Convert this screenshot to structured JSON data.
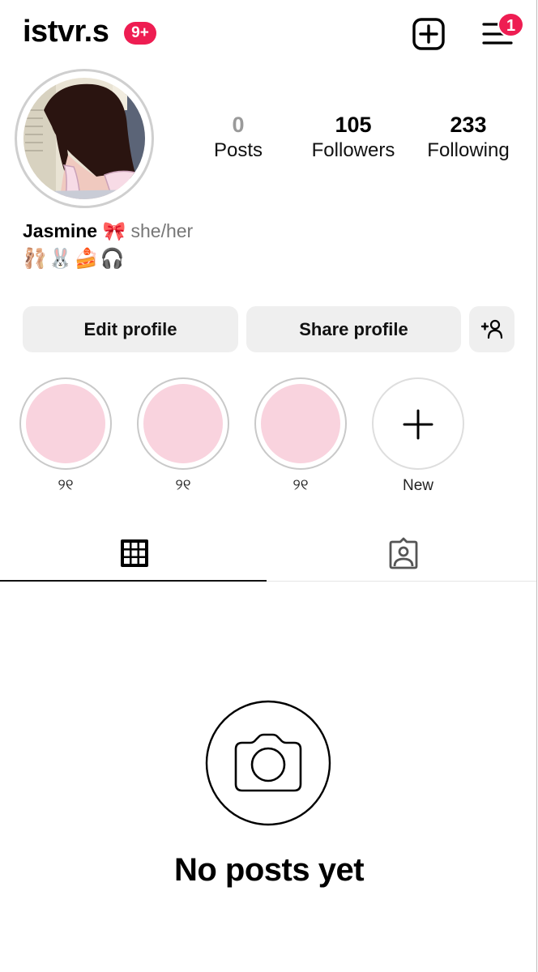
{
  "header": {
    "username": "istvr.s",
    "notification_badge": "9+",
    "create_icon": "plus-square-icon",
    "menu_icon": "hamburger-menu-icon",
    "menu_badge": "1",
    "badge_color": "#ee1d52"
  },
  "profile": {
    "avatar_icon": "profile-photo",
    "stats": [
      {
        "value": "0",
        "label": "Posts"
      },
      {
        "value": "105",
        "label": "Followers"
      },
      {
        "value": "233",
        "label": "Following"
      }
    ],
    "display_name": "Jasmine",
    "name_emoji": "🎀",
    "pronouns": "she/her",
    "bio": "🩰🐰🍰🎧"
  },
  "actions": {
    "edit_label": "Edit profile",
    "share_label": "Share profile",
    "discover_icon": "add-person-icon"
  },
  "highlights": [
    {
      "label": "୨୧",
      "color": "#f9d3de"
    },
    {
      "label": "୨୧",
      "color": "#f9d3de"
    },
    {
      "label": "୨୧",
      "color": "#f9d3de"
    },
    {
      "label": "New",
      "icon": "plus-icon"
    }
  ],
  "tabs": [
    {
      "name": "posts-grid",
      "icon": "grid-icon",
      "active": true
    },
    {
      "name": "tagged",
      "icon": "tagged-person-icon",
      "active": false
    }
  ],
  "empty_state": {
    "icon": "camera-icon",
    "text": "No posts yet"
  }
}
